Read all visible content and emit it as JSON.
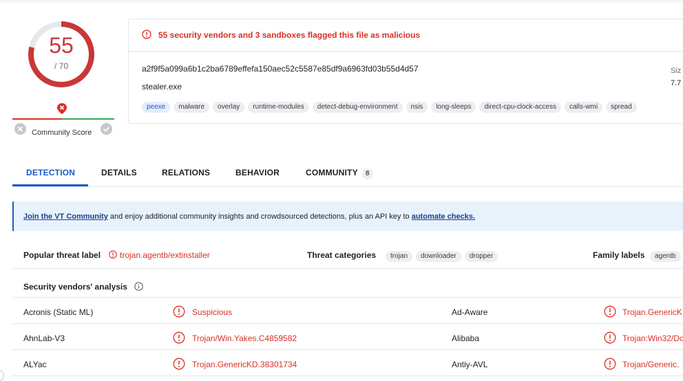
{
  "score": {
    "value": "55",
    "total": "/ 70",
    "fraction": 0.786,
    "community_label": "Community Score"
  },
  "alert": "55 security vendors and 3 sandboxes flagged this file as malicious",
  "file": {
    "hash": "a2f9f5a099a6b1c2ba6789effefa150aec52c5587e85df9a6963fd03b55d4d57",
    "name": "stealer.exe",
    "size_label": "Siz",
    "size_value": "7.7",
    "tags": [
      "peexe",
      "malware",
      "overlay",
      "runtime-modules",
      "detect-debug-environment",
      "nsis",
      "long-sleeps",
      "direct-cpu-clock-access",
      "calls-wmi",
      "spread"
    ]
  },
  "tabs": [
    {
      "label": "DETECTION"
    },
    {
      "label": "DETAILS"
    },
    {
      "label": "RELATIONS"
    },
    {
      "label": "BEHAVIOR"
    },
    {
      "label": "COMMUNITY",
      "badge": "8"
    }
  ],
  "banner": {
    "link1": "Join the VT Community",
    "text": " and enjoy additional community insights and crowdsourced detections, plus an API key to ",
    "link2": "automate checks."
  },
  "threat": {
    "popular_label": "Popular threat label",
    "popular_value": "trojan.agentb/extinstaller",
    "categories_label": "Threat categories",
    "categories": [
      "trojan",
      "downloader",
      "dropper"
    ],
    "family_label": "Family labels",
    "family_value": "agentb"
  },
  "vendors": {
    "title": "Security vendors' analysis",
    "rows": [
      {
        "vendor": "Acronis (Static ML)",
        "result": "Suspicious",
        "vendor2": "Ad-Aware",
        "result2": "Trojan.GenericK"
      },
      {
        "vendor": "AhnLab-V3",
        "result": "Trojan/Win.Yakes.C4859582",
        "vendor2": "Alibaba",
        "result2": "Trojan:Win32/Do"
      },
      {
        "vendor": "ALYac",
        "result": "Trojan.GenericKD.38301734",
        "vendor2": "Antiy-AVL",
        "result2": "Trojan/Generic."
      }
    ]
  },
  "colors": {
    "accent": "#1a59c9",
    "danger": "#d93025",
    "score_ring": "#c93838"
  }
}
